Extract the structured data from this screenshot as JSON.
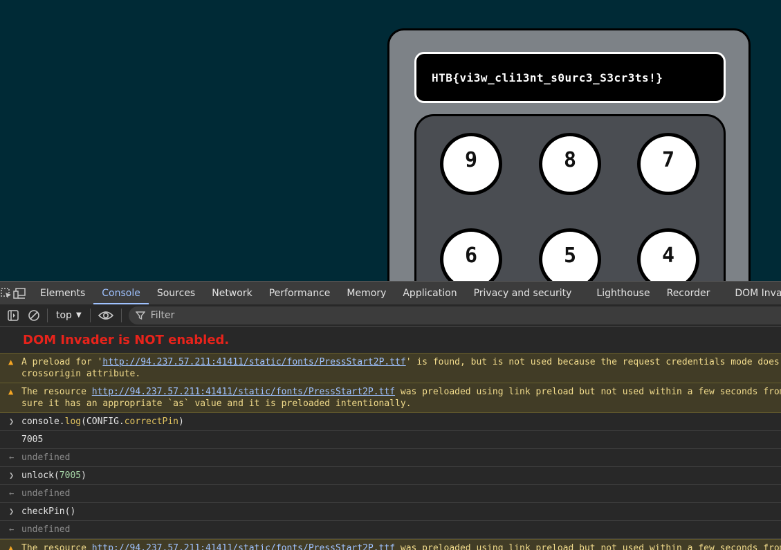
{
  "page": {
    "screen_text": "HTB{vi3w_cli13nt_s0urc3_S3cr3ts!}",
    "keys": [
      "9",
      "8",
      "7",
      "6",
      "5",
      "4"
    ]
  },
  "devtools": {
    "tabs": [
      "Elements",
      "Console",
      "Sources",
      "Network",
      "Performance",
      "Memory",
      "Application",
      "Privacy and security",
      "Lighthouse",
      "Recorder",
      "DOM Invader"
    ],
    "active_tab": "Console",
    "context": "top",
    "filter_placeholder": "Filter"
  },
  "console": {
    "banner": "DOM Invader is NOT enabled.",
    "warn1": {
      "pre": "A preload for '",
      "url": "http://94.237.57.211:41411/static/fonts/PressStart2P.ttf",
      "post": "' is found, but is not used because the request credentials mode does not match. Consider taking a look at",
      "line2": "crossorigin attribute."
    },
    "warn2": {
      "pre": "The resource ",
      "url": "http://94.237.57.211:41411/static/fonts/PressStart2P.ttf",
      "post": " was preloaded using link preload but not used within a few seconds from the window's load event. Please make",
      "line2": "sure it has an appropriate `as` value and it is preloaded intentionally."
    },
    "cmd1": {
      "obj1": "console",
      "dot1": ".",
      "fn": "log",
      "open": "(",
      "obj2": "CONFIG",
      "dot2": ".",
      "prop": "correctPin",
      "close": ")"
    },
    "out1": "7005",
    "res1": "undefined",
    "cmd2": {
      "fn": "unlock",
      "open": "(",
      "arg": "7005",
      "close": ")"
    },
    "res2": "undefined",
    "cmd3": "checkPin()",
    "res3": "undefined",
    "warn3": {
      "pre": "The resource ",
      "url": "http://94.237.57.211:41411/static/fonts/PressStart2P.ttf",
      "post": " was preloaded using link preload but not used within a few seconds from the window's load event."
    }
  },
  "icons": {
    "inspect": "inspect-element-icon",
    "device": "device-toolbar-icon",
    "sidebar": "console-sidebar-icon",
    "clear": "clear-console-icon",
    "eye": "live-expression-eye-icon",
    "filter": "filter-icon",
    "warning": "warning-icon",
    "prompt": "prompt-chevron-icon",
    "result": "result-arrow-icon"
  }
}
